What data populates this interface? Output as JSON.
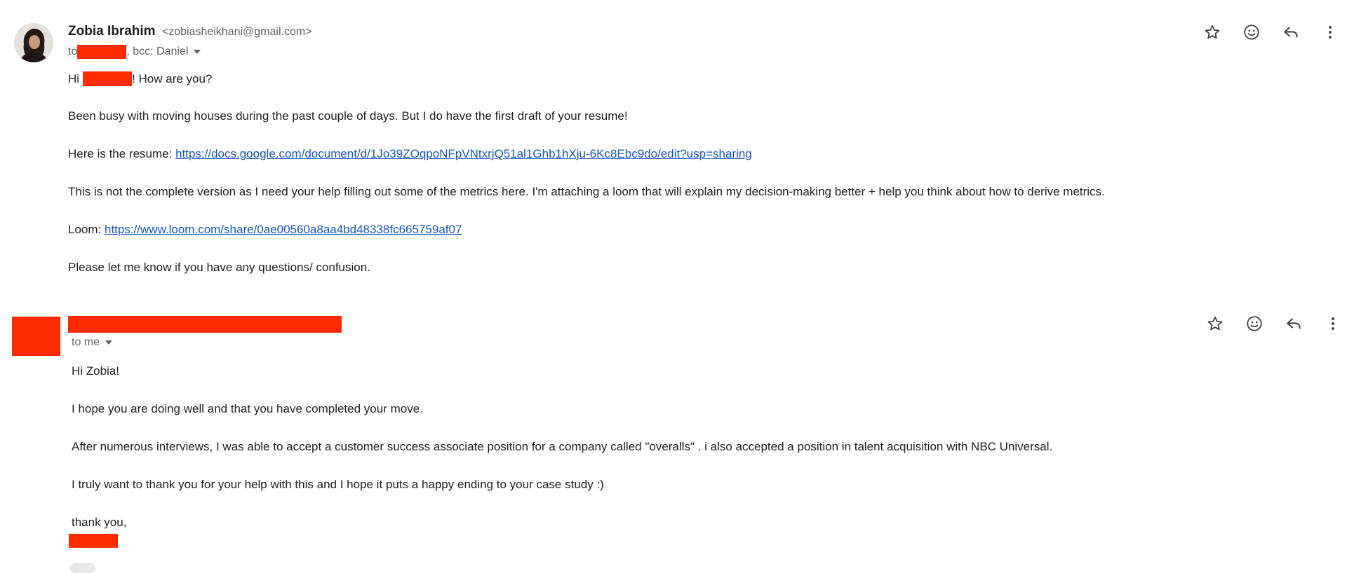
{
  "icons": [
    "star-icon",
    "emoji-icon",
    "reply-icon",
    "more-icon"
  ],
  "colors": {
    "redaction": "#ff2a00",
    "link": "#1a55c8",
    "text": "#222222",
    "meta": "#5f6368"
  },
  "message1": {
    "sender_name": "Zobia Ibrahim",
    "sender_email": "<zobiasheikhani@gmail.com>",
    "to_prefix": "to",
    "recipients_rest": ", bcc: Daniel",
    "greeting_prefix": "Hi",
    "greeting_suffix": "! How are you?",
    "paragraph1": "Been busy with moving houses during the past couple of days. But I do have the first draft of your resume!",
    "resume_prefix": "Here is the resume: ",
    "resume_link": "https://docs.google.com/document/d/1Jo39ZOqpoNFpVNtxrjQ51al1Ghb1hXju-6Kc8Ebc9do/edit?usp=sharing",
    "paragraph2": "This is not the complete version as I need your help filling out some of the metrics here. I'm attaching a loom that will explain my decision-making better + help you think about how to derive metrics.",
    "loom_prefix": "Loom: ",
    "loom_link": "https://www.loom.com/share/0ae00560a8aa4bd48338fc665759af07",
    "paragraph3": "Please let me know if you have any questions/ confusion."
  },
  "message2": {
    "to_label": "to me",
    "greeting": "Hi Zobia!",
    "paragraph1": "I hope you are doing well and that you have completed your move.",
    "paragraph2": "After numerous interviews, I was able to accept a customer success associate position for a company called \"overalls\" . i also accepted a position in talent acquisition with NBC Universal.",
    "paragraph3": "I truly want to thank you for your help with this and I hope it puts a happy ending to your case study :)",
    "signoff": "thank you,"
  }
}
